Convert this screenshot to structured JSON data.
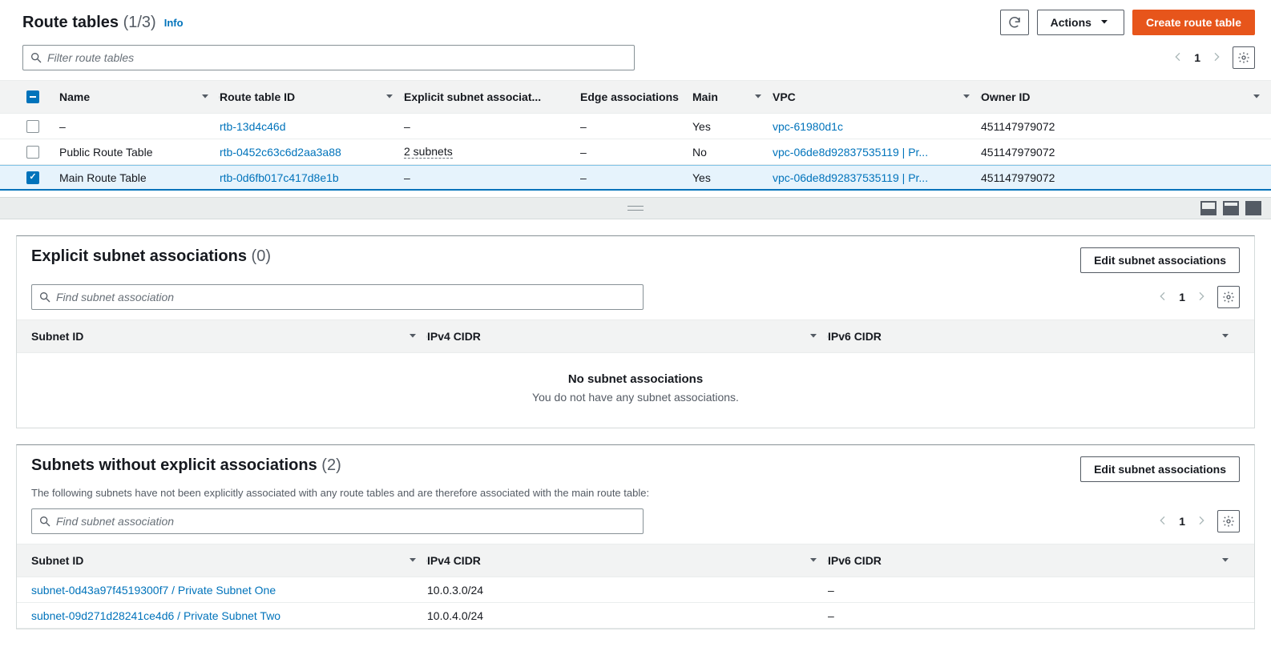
{
  "header": {
    "title": "Route tables",
    "count": "(1/3)",
    "info": "Info",
    "actions_label": "Actions",
    "create_label": "Create route table"
  },
  "filter": {
    "placeholder": "Filter route tables",
    "page": "1"
  },
  "table": {
    "columns": {
      "name": "Name",
      "rtid": "Route table ID",
      "explicit": "Explicit subnet associat...",
      "edge": "Edge associations",
      "main": "Main",
      "vpc": "VPC",
      "owner": "Owner ID"
    },
    "rows": [
      {
        "selected": false,
        "name": "–",
        "rtid": "rtb-13d4c46d",
        "explicit": "–",
        "explicit_dotted": false,
        "edge": "–",
        "main": "Yes",
        "vpc": "vpc-61980d1c",
        "owner": "451147979072"
      },
      {
        "selected": false,
        "name": "Public Route Table",
        "rtid": "rtb-0452c63c6d2aa3a88",
        "explicit": "2 subnets",
        "explicit_dotted": true,
        "edge": "–",
        "main": "No",
        "vpc": "vpc-06de8d92837535119 | Pr...",
        "owner": "451147979072"
      },
      {
        "selected": true,
        "name": "Main Route Table",
        "rtid": "rtb-0d6fb017c417d8e1b",
        "explicit": "–",
        "explicit_dotted": false,
        "edge": "–",
        "main": "Yes",
        "vpc": "vpc-06de8d92837535119 | Pr...",
        "owner": "451147979072"
      }
    ]
  },
  "explicit_panel": {
    "title": "Explicit subnet associations",
    "count": "(0)",
    "edit_label": "Edit subnet associations",
    "filter_placeholder": "Find subnet association",
    "page": "1",
    "columns": {
      "subnet": "Subnet ID",
      "v4": "IPv4 CIDR",
      "v6": "IPv6 CIDR"
    },
    "empty_title": "No subnet associations",
    "empty_desc": "You do not have any subnet associations."
  },
  "implicit_panel": {
    "title": "Subnets without explicit associations",
    "count": "(2)",
    "desc": "The following subnets have not been explicitly associated with any route tables and are therefore associated with the main route table:",
    "edit_label": "Edit subnet associations",
    "filter_placeholder": "Find subnet association",
    "page": "1",
    "columns": {
      "subnet": "Subnet ID",
      "v4": "IPv4 CIDR",
      "v6": "IPv6 CIDR"
    },
    "rows": [
      {
        "subnet": "subnet-0d43a97f4519300f7 / Private Subnet One",
        "v4": "10.0.3.0/24",
        "v6": "–"
      },
      {
        "subnet": "subnet-09d271d28241ce4d6 / Private Subnet Two",
        "v4": "10.0.4.0/24",
        "v6": "–"
      }
    ]
  }
}
